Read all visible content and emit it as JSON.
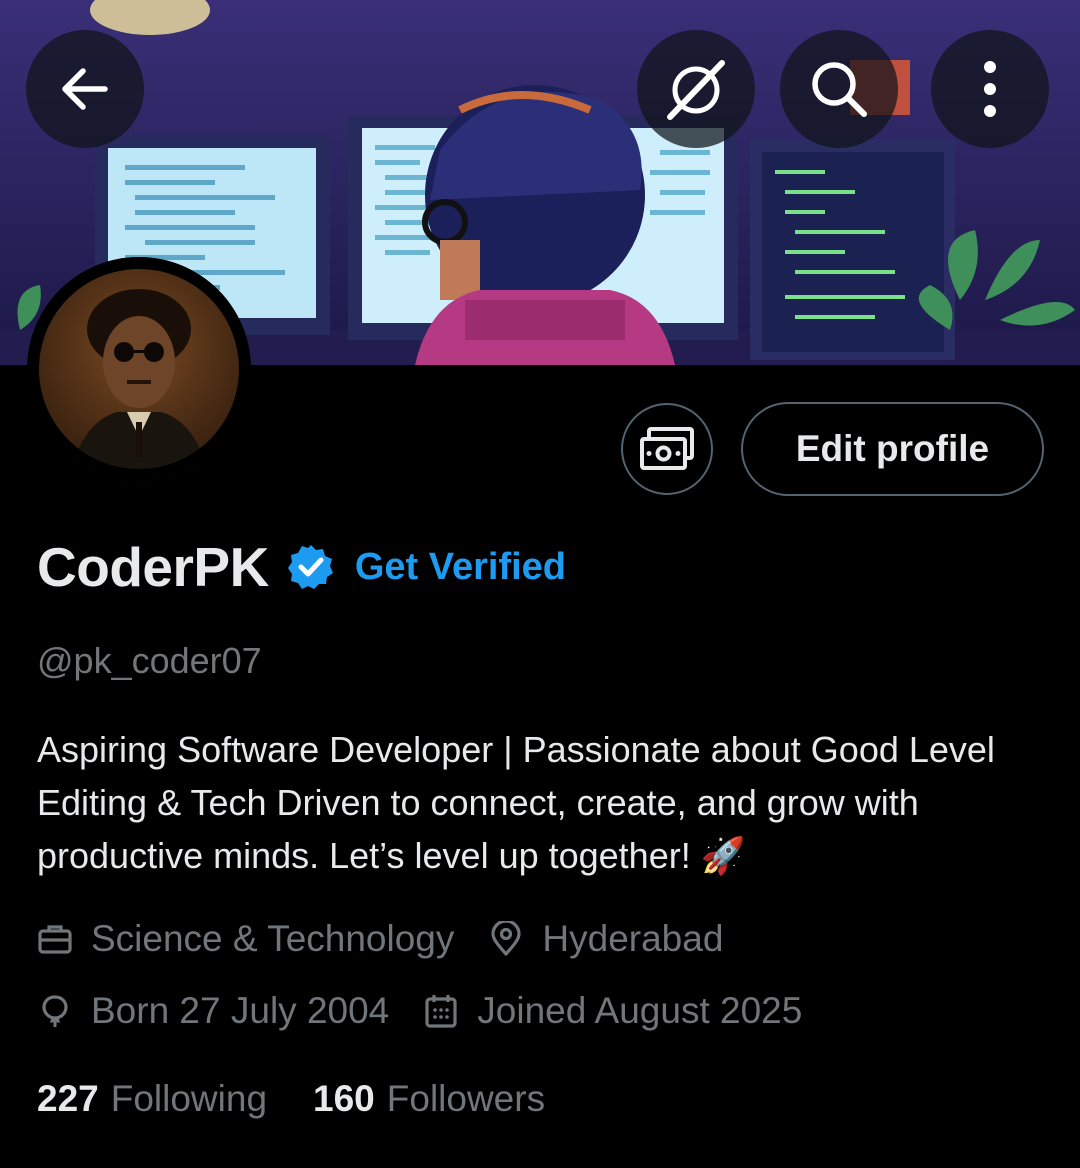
{
  "header": {
    "back_icon": "arrow-left-icon",
    "grok_icon": "grok-icon",
    "search_icon": "search-icon",
    "more_icon": "more-vertical-icon"
  },
  "profile": {
    "display_name": "CoderPK",
    "get_verified_label": "Get Verified",
    "handle": "@pk_coder07",
    "bio": "Aspiring Software Developer | Passionate about Good Level Editing & Tech Driven to connect, create, and grow with productive minds. Let’s level up together! 🚀",
    "edit_profile_label": "Edit profile",
    "category": "Science & Technology",
    "location": "Hyderabad",
    "birthday": "Born 27 July 2004",
    "joined": "Joined August 2025",
    "following_count": "227",
    "following_label": "Following",
    "followers_count": "160",
    "followers_label": "Followers"
  },
  "colors": {
    "background": "#000000",
    "text_primary": "#e7e9ea",
    "text_secondary": "#71767b",
    "accent_blue": "#1d9bf0",
    "border": "#536471"
  }
}
